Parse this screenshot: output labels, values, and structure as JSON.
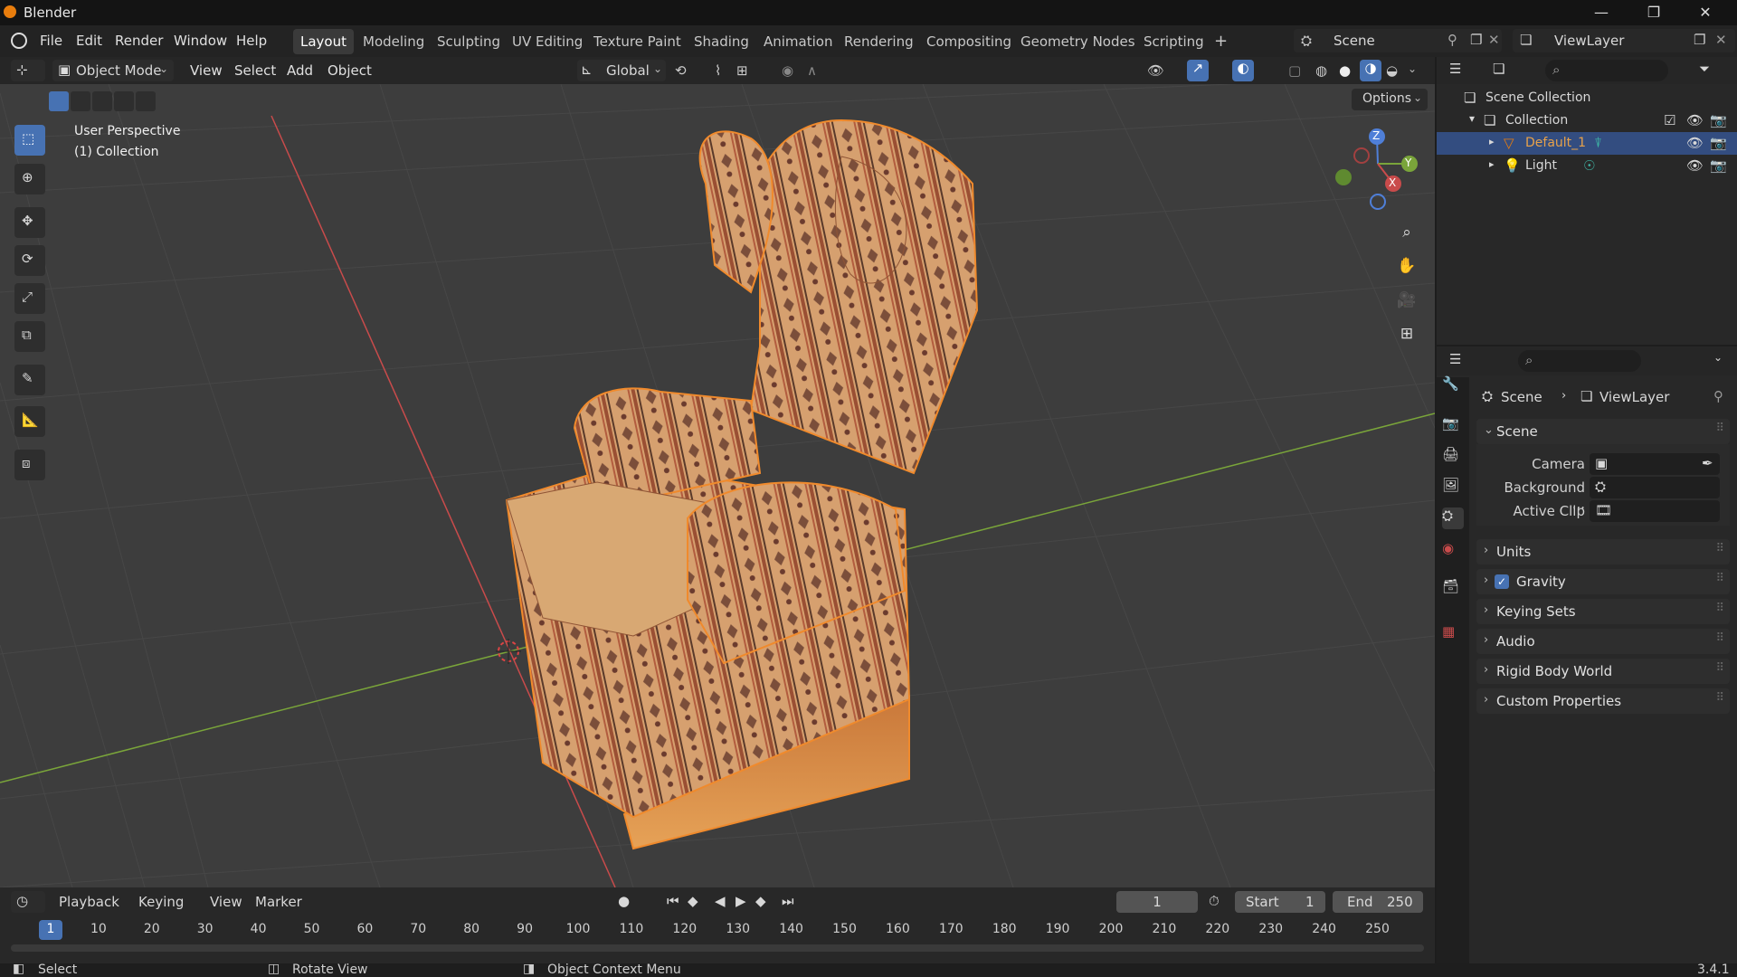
{
  "window": {
    "title": "Blender",
    "controls": [
      "—",
      "❐",
      "✕"
    ]
  },
  "menu": [
    "File",
    "Edit",
    "Render",
    "Window",
    "Help"
  ],
  "workspaces": [
    "Layout",
    "Modeling",
    "Sculpting",
    "UV Editing",
    "Texture Paint",
    "Shading",
    "Animation",
    "Rendering",
    "Compositing",
    "Geometry Nodes",
    "Scripting",
    "+"
  ],
  "scene_field": "Scene",
  "viewlayer_field": "ViewLayer",
  "viewport_header": {
    "mode": "Object Mode",
    "menus": [
      "View",
      "Select",
      "Add",
      "Object"
    ],
    "transform_orientation": "Global",
    "options": "Options"
  },
  "viewport": {
    "perspective": "User Perspective",
    "collection": "(1) Collection",
    "gizmo_axes": {
      "x": "X",
      "y": "Y",
      "z": "Z"
    }
  },
  "outliner": {
    "items": [
      {
        "label": "Scene Collection"
      },
      {
        "label": "Collection"
      },
      {
        "label": "Default_1"
      },
      {
        "label": "Light"
      }
    ]
  },
  "properties": {
    "breadcrumb": [
      "Scene",
      "ViewLayer"
    ],
    "panel_title": "Scene",
    "fields": [
      "Camera",
      "Background ...",
      "Active Clip"
    ],
    "panels": [
      "Units",
      "Gravity",
      "Keying Sets",
      "Audio",
      "Rigid Body World",
      "Custom Properties"
    ],
    "gravity_checked": true
  },
  "timeline": {
    "menus": [
      "Playback",
      "Keying",
      "View",
      "Marker"
    ],
    "current_frame": "1",
    "start_label": "Start",
    "start_value": "1",
    "end_label": "End",
    "end_value": "250",
    "ticks": [
      "1",
      "10",
      "20",
      "30",
      "40",
      "50",
      "60",
      "70",
      "80",
      "90",
      "100",
      "110",
      "120",
      "130",
      "140",
      "150",
      "160",
      "170",
      "180",
      "190",
      "200",
      "210",
      "220",
      "230",
      "240",
      "250"
    ]
  },
  "status": {
    "select": "Select",
    "rotate": "Rotate View",
    "context": "Object Context Menu",
    "version": "3.4.1"
  },
  "colors": {
    "accent": "#4772b3",
    "selection_orange": "#e87d0d",
    "x_axis": "#c94b4b",
    "y_axis": "#7aa53a"
  }
}
